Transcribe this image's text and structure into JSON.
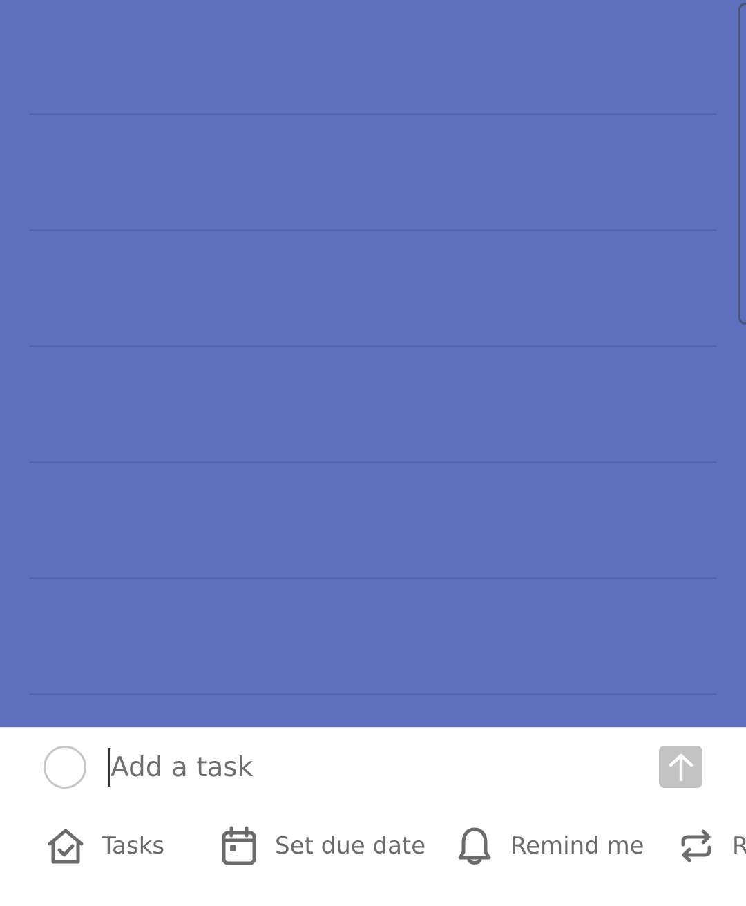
{
  "colors": {
    "list_background": "#5e70bd",
    "ruled_line": "#5465b0",
    "composer_background": "#ffffff",
    "icon_gray": "#6b6b6b",
    "send_button_disabled": "#c3c3c3"
  },
  "composer": {
    "placeholder": "Add a task",
    "value": "",
    "send_icon": "arrow-up-icon"
  },
  "toolbar": {
    "items": [
      {
        "label": "Tasks",
        "icon": "house-check-icon"
      },
      {
        "label": "Set due date",
        "icon": "calendar-icon"
      },
      {
        "label": "Remind me",
        "icon": "bell-icon"
      },
      {
        "label": "R",
        "icon": "repeat-icon"
      }
    ]
  }
}
